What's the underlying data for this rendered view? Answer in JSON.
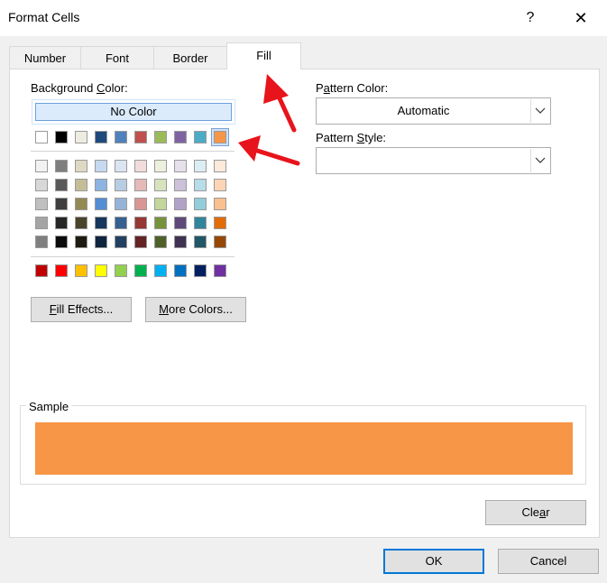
{
  "window": {
    "title": "Format Cells",
    "help_glyph": "?",
    "close_glyph": "✕"
  },
  "tabs": [
    {
      "label": "Number",
      "active": false
    },
    {
      "label": "Font",
      "active": false
    },
    {
      "label": "Border",
      "active": false
    },
    {
      "label": "Fill",
      "active": true
    }
  ],
  "background_color": {
    "label_pre": "Background ",
    "label_accel": "C",
    "label_post": "olor:",
    "no_color_label": "No Color",
    "selected_color": "#f79646",
    "theme_row": [
      "#ffffff",
      "#000000",
      "#eeece1",
      "#1f497d",
      "#4f81bd",
      "#c0504d",
      "#9bbb59",
      "#8064a2",
      "#4bacc6",
      "#f79646"
    ],
    "tints": [
      [
        "#f2f2f2",
        "#7f7f7f",
        "#ddd9c3",
        "#c6d9f0",
        "#dbe5f1",
        "#f2dcdb",
        "#ebf1dd",
        "#e5e0ec",
        "#dbeef3",
        "#fdeada"
      ],
      [
        "#d8d8d8",
        "#595959",
        "#c4bd97",
        "#8db3e2",
        "#b8cce4",
        "#e5b9b7",
        "#d7e3bc",
        "#ccc1d9",
        "#b7dde8",
        "#fbd5b5"
      ],
      [
        "#bfbfbf",
        "#3f3f3f",
        "#938953",
        "#548dd4",
        "#95b3d7",
        "#d99694",
        "#c3d69b",
        "#b2a2c7",
        "#92cddc",
        "#fac08f"
      ],
      [
        "#a5a5a5",
        "#262626",
        "#494429",
        "#17365d",
        "#366092",
        "#953734",
        "#76923c",
        "#5f497a",
        "#31859b",
        "#e36c09"
      ],
      [
        "#7f7f7f",
        "#0c0c0c",
        "#1d1b10",
        "#0f243e",
        "#244061",
        "#632423",
        "#4f6128",
        "#3f3151",
        "#205867",
        "#974806"
      ]
    ],
    "standard_row": [
      "#c00000",
      "#ff0000",
      "#ffc000",
      "#ffff00",
      "#92d050",
      "#00b050",
      "#00b0f0",
      "#0070c0",
      "#002060",
      "#7030a0"
    ]
  },
  "buttons": {
    "fill_effects": {
      "accel": "F",
      "rest": "ill Effects..."
    },
    "more_colors": {
      "accel": "M",
      "rest": "ore Colors..."
    },
    "clear": {
      "pre": "Cle",
      "accel": "a",
      "post": "r"
    },
    "ok": "OK",
    "cancel": "Cancel"
  },
  "pattern": {
    "color_label_pre": "P",
    "color_label_accel": "a",
    "color_label_post": "ttern Color:",
    "color_value": "Automatic",
    "style_label_pre": "Pattern ",
    "style_label_accel": "S",
    "style_label_post": "tyle:",
    "style_value": ""
  },
  "sample": {
    "label": "Sample",
    "color": "#f79646"
  },
  "annotation_color": "#e8141c"
}
